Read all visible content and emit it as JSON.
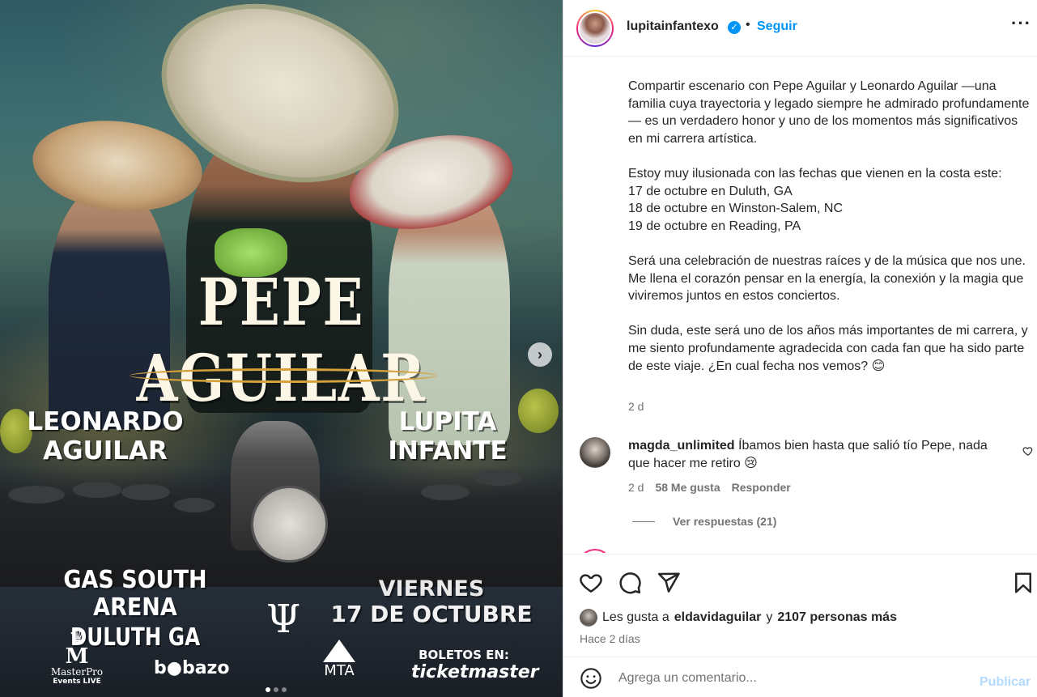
{
  "poster": {
    "title": "PEPE AGUILAR",
    "left_name_line1": "LEONARDO",
    "left_name_line2": "AGUILAR",
    "right_name_line1": "LUPITA",
    "right_name_line2": "INFANTE",
    "venue_line1": "GAS SOUTH ARENA",
    "venue_line2": "DULUTH GA",
    "day": "VIERNES",
    "date": "17 DE OCTUBRE",
    "logos": {
      "masterpro_letter": "M",
      "masterpro_line1": "MasterPro",
      "masterpro_line2": "Events LIVE",
      "bombazo": "b●bazo",
      "mta": "MTA",
      "tickets_label": "BOLETOS EN:",
      "ticketmaster": "ticketmaster"
    },
    "carousel": {
      "slides": 3,
      "active_index": 0
    }
  },
  "header": {
    "username": "lupitainfantexo",
    "separator": "•",
    "follow_label": "Seguir"
  },
  "caption": {
    "text": "Compartir escenario con Pepe Aguilar y Leonardo Aguilar —una familia cuya trayectoria y legado siempre he admirado profundamente— es un verdadero honor y uno de los momentos más significativos en mi carrera artística.\n\nEstoy muy ilusionada con las fechas que vienen en la costa este:\n17 de octubre en Duluth, GA\n18 de octubre en Winston-Salem, NC\n19 de octubre en Reading, PA\n\nSerá una celebración de nuestras raíces y de la música que nos une.\nMe llena el corazón pensar en la energía, la conexión y la magia que viviremos juntos en estos conciertos.\n\nSin duda, este será uno de los años más importantes de mi carrera, y me siento profundamente agradecida con cada fan que ha sido parte de este viaje. ¿En cual fecha nos vemos? 😊",
    "time": "2 d"
  },
  "comment": {
    "username": "magda_unlimited",
    "text": "Íbamos bien hasta que salió tío Pepe, nada que hacer me retiro 😢",
    "time": "2 d",
    "likes": "58 Me gusta",
    "reply_label": "Responder",
    "view_replies": "Ver respuestas (21)"
  },
  "likes": {
    "prefix": "Les gusta a",
    "liker": "eldavidaguilar",
    "and": "y",
    "others": "2107 personas más"
  },
  "time_ago": "Hace 2 días",
  "comment_box": {
    "placeholder": "Agrega un comentario...",
    "publish_label": "Publicar"
  }
}
